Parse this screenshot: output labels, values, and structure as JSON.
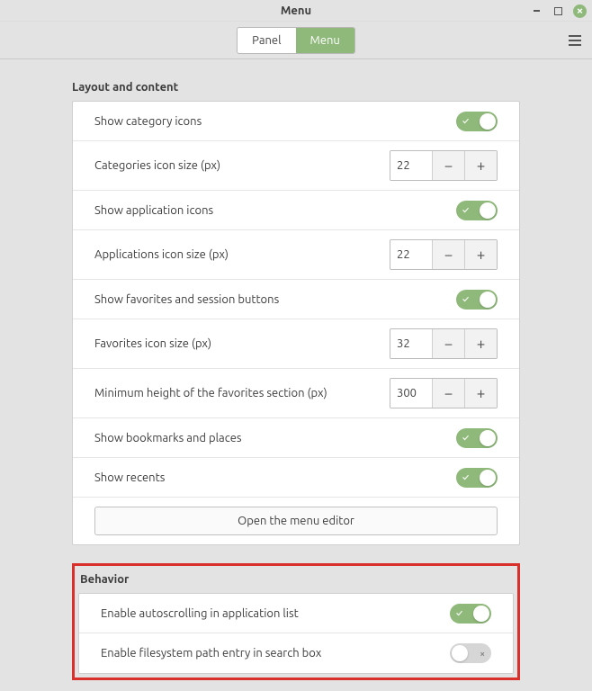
{
  "window": {
    "title": "Menu"
  },
  "tabs": {
    "panel": "Panel",
    "menu": "Menu"
  },
  "sections": {
    "layout": {
      "heading": "Layout and content",
      "rows": {
        "show_category_icons": {
          "label": "Show category icons",
          "on": true
        },
        "categories_icon_size": {
          "label": "Categories icon size (px)",
          "value": "22"
        },
        "show_application_icons": {
          "label": "Show application icons",
          "on": true
        },
        "applications_icon_size": {
          "label": "Applications icon size (px)",
          "value": "22"
        },
        "show_favorites": {
          "label": "Show favorites and session buttons",
          "on": true
        },
        "favorites_icon_size": {
          "label": "Favorites icon size (px)",
          "value": "32"
        },
        "min_height_favorites": {
          "label": "Minimum height of the favorites section (px)",
          "value": "300"
        },
        "show_bookmarks": {
          "label": "Show bookmarks and places",
          "on": true
        },
        "show_recents": {
          "label": "Show recents",
          "on": true
        },
        "menu_editor_button": "Open the menu editor"
      }
    },
    "behavior": {
      "heading": "Behavior",
      "rows": {
        "autoscrolling": {
          "label": "Enable autoscrolling in application list",
          "on": true
        },
        "filesystem_path": {
          "label": "Enable filesystem path entry in search box",
          "on": false
        }
      }
    }
  }
}
